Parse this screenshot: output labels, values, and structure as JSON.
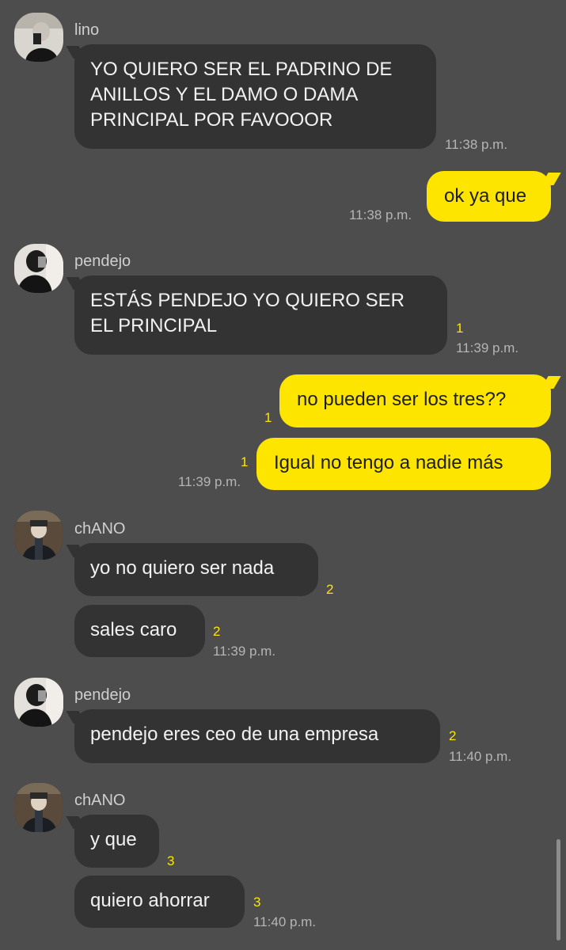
{
  "messages": [
    {
      "sender": "lino",
      "text_lines": [
        "YO QUIERO SER EL PADRINO DE",
        "ANILLOS Y EL DAMO O DAMA",
        "PRINCIPAL POR FAVOOOR"
      ],
      "time": "11:38 p.m."
    },
    {
      "sender": "me",
      "text": "ok ya que",
      "time": "11:38 p.m."
    },
    {
      "sender": "pendejo",
      "text_lines": [
        "ESTÁS PENDEJO YO QUIERO SER",
        "EL PRINCIPAL"
      ],
      "unread": "1",
      "time": "11:39 p.m."
    },
    {
      "sender": "me",
      "text": "no pueden ser los tres??",
      "unread": "1"
    },
    {
      "sender": "me",
      "text": "Igual no tengo a nadie más",
      "unread": "1",
      "time": "11:39 p.m."
    },
    {
      "sender": "chANO",
      "text": "yo no quiero ser nada",
      "unread": "2"
    },
    {
      "sender": "chANO",
      "text": "sales caro",
      "unread": "2",
      "time": "11:39 p.m."
    },
    {
      "sender": "pendejo",
      "text": "pendejo eres ceo de una empresa",
      "unread": "2",
      "time": "11:40 p.m."
    },
    {
      "sender": "chANO",
      "text": "y que",
      "unread": "3"
    },
    {
      "sender": "chANO",
      "text": "quiero ahorrar",
      "unread": "3",
      "time": "11:40 p.m."
    }
  ],
  "avatars": {
    "lino": "profile-photo",
    "pendejo": "profile-photo",
    "chANO": "profile-photo"
  },
  "colors": {
    "background": "#4e4d4d",
    "incoming_bubble": "#333333",
    "outgoing_bubble": "#fee500",
    "unread_count": "#fee500",
    "timestamp": "#b5b5b5"
  }
}
